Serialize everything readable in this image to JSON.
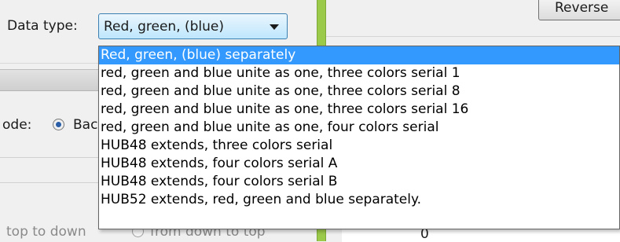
{
  "data_type": {
    "label": "Data type:",
    "selected_value": "Red, green, (blue)",
    "options": [
      "Red, green, (blue) separately",
      "red, green and blue unite as one, three colors serial 1",
      "red, green and blue unite as one, three colors serial 8",
      "red, green and blue unite as one, three colors serial 16",
      "red, green and blue unite as one, four colors serial",
      "HUB48 extends, three colors serial",
      "HUB48 extends, four colors serial A",
      "HUB48 extends, four colors serial B",
      "HUB52 extends, red, green and blue separately."
    ],
    "highlighted_index": 0
  },
  "mode": {
    "label": "ode:",
    "radio_label": "Bac"
  },
  "bottom": {
    "left_text": "top to down",
    "radio_label": "from down to top"
  },
  "right_panel": {
    "reverse_button_label": "Reverse",
    "cell_value": "0"
  },
  "colors": {
    "selection": "#3399ff",
    "splitter": "#9bc94a"
  }
}
